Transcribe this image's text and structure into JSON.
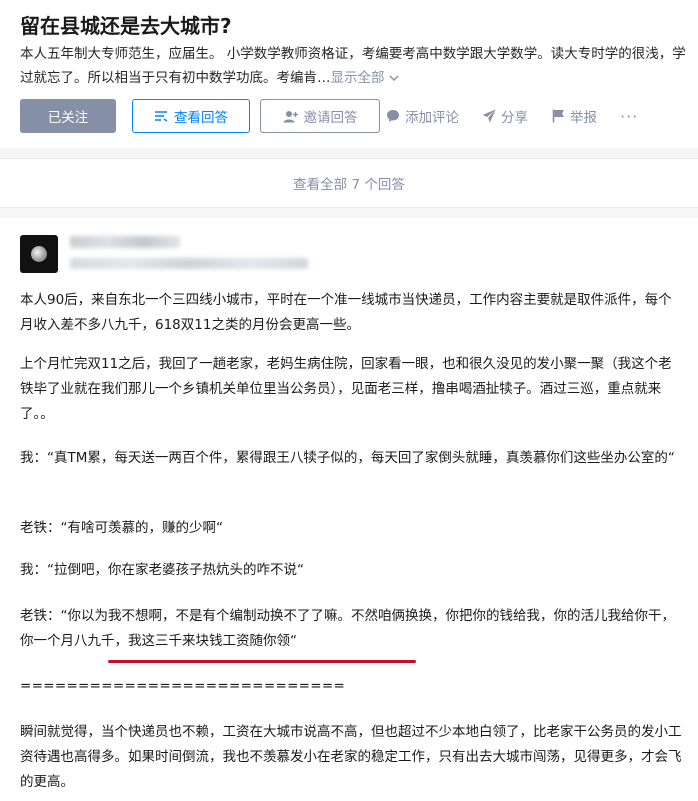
{
  "question": {
    "title": "留在县城还是去大城市?",
    "detail": "本人五年制大专师范生，应届生。 小学数学教师资格证，考编要考高中数学跟大学数学。读大专时学的很浅，学过就忘了。所以相当于只有初中数学功底。考编肯…",
    "show_all": "显示全部"
  },
  "actions": {
    "followed": "已关注",
    "view_answers": "查看回答",
    "invite": "邀请回答",
    "comment": "添加评论",
    "share": "分享",
    "report": "举报",
    "more": "···"
  },
  "view_all": "查看全部 7 个回答",
  "answer": {
    "p1": "本人90后，来自东北一个三四线小城市，平时在一个准一线城市当快递员，工作内容主要就是取件派件，每个月收入差不多八九千，618双11之类的月份会更高一些。",
    "p2": "上个月忙完双11之后，我回了一趟老家，老妈生病住院，回家看一眼，也和很久没见的发小聚一聚（我这个老铁毕了业就在我们那儿一个乡镇机关单位里当公务员），见面老三样，撸串喝酒扯犊子。酒过三巡，重点就来了。。",
    "p3": "我：“真TM累，每天送一两百个件，累得跟王八犊子似的，每天回了家倒头就睡，真羡慕你们这些坐办公室的“",
    "p4": "老铁：“有啥可羡慕的，赚的少啊“",
    "p5": "我：“拉倒吧，你在家老婆孩子热炕头的咋不说“",
    "p6a": "老铁：“你以为我不想啊，不是有个编制动换不了了嘛。不然咱俩换换，你把你的钱给我，你的活儿我给你干，",
    "p6b": "你一个月八九千，我这三千来块钱工资随你领“",
    "p7": "============================",
    "p8": "瞬间就觉得，当个快递员也不赖，工资在大城市说高不高，但也超过不少本地白领了，比老家干公务员的发小工资待遇也高得多。如果时间倒流，我也不羡慕发小在老家的稳定工作，只有出去大城市闯荡，见得更多，才会飞的更高。"
  },
  "colors": {
    "brand_blue": "#0084ff",
    "gray": "#8590a6",
    "underline_red": "#c8102e"
  }
}
